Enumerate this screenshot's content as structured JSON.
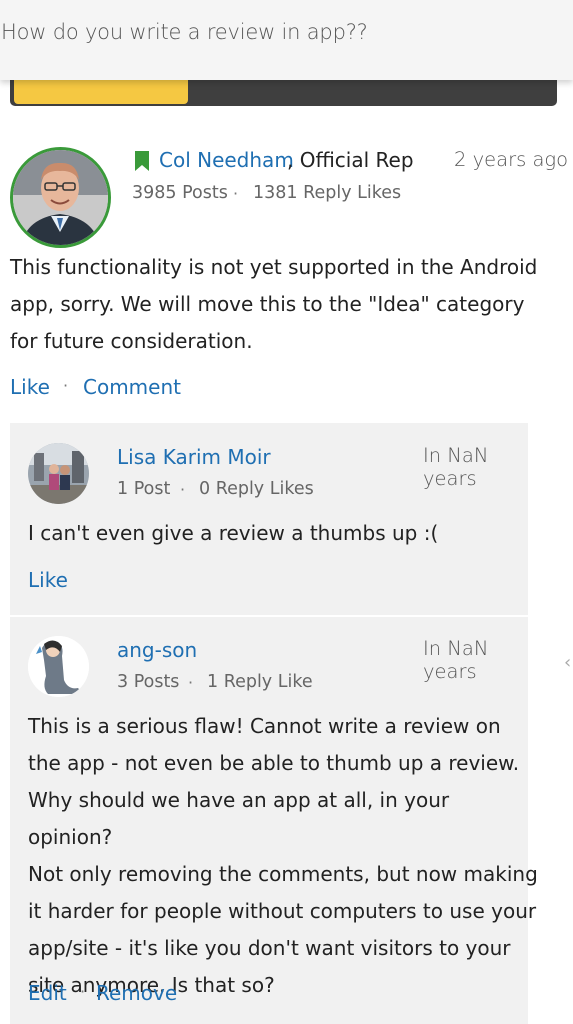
{
  "page": {
    "title": "How do you write a review in app??"
  },
  "progress": {
    "fraction": 0.32,
    "fill_color": "#f5c842",
    "track_color": "#3f3f3f"
  },
  "post": {
    "author": "Col Needham",
    "role": ", Official Rep",
    "badge_icon": "bookmark-icon",
    "timestamp": "2 years ago",
    "posts": "3985 Posts",
    "reply_likes": "1381 Reply Likes",
    "body": "This functionality is not yet supported in the Android app, sorry. We will move this to the \"Idea\" category for future consideration.",
    "actions": {
      "like": "Like",
      "comment": "Comment"
    }
  },
  "comments": [
    {
      "author": "Lisa Karim Moir",
      "timestamp": "In NaN years",
      "posts": "1 Post",
      "reply_likes": "0 Reply Likes",
      "body": "I can't even give a review a thumbs up :(",
      "actions": {
        "like": "Like"
      }
    },
    {
      "author": "ang-son",
      "timestamp": "In NaN years",
      "posts": "3 Posts",
      "reply_likes": "1 Reply Like",
      "body": "This is a serious flaw! Cannot write a review on the app - not even be able to thumb up a review. Why should we have an app at all, in your opinion?\nNot only removing the comments, but now making it harder for people without computers to use your app/site - it's like you don't want visitors to your site anymore. Is that so?",
      "actions": {
        "edit": "Edit",
        "remove": "Remove"
      }
    }
  ],
  "colors": {
    "link": "#1f6fb2",
    "accent_green": "#3a9a3a"
  }
}
